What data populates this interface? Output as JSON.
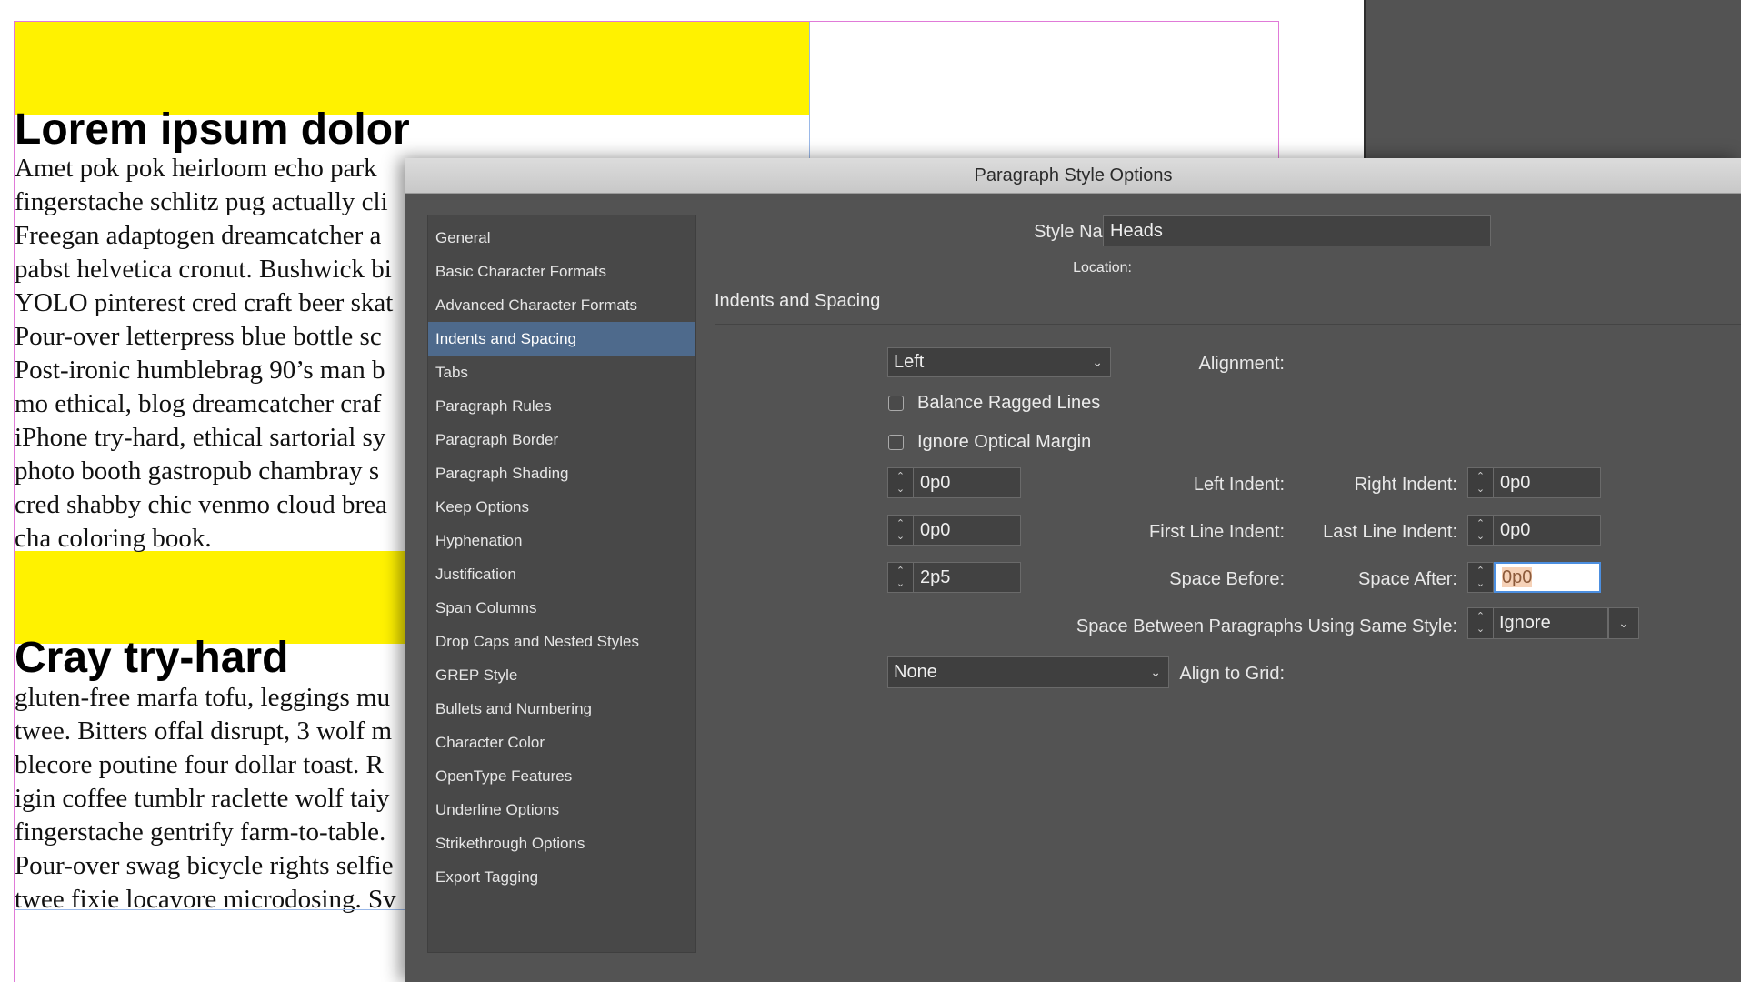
{
  "document": {
    "heading1": "Lorem ipsum dolor",
    "paragraph1": [
      "Amet pok pok heirloom echo park",
      "fingerstache schlitz pug actually cli",
      "Freegan adaptogen dreamcatcher a",
      "pabst helvetica cronut. Bushwick bi",
      "YOLO pinterest cred craft beer skat",
      "Pour-over letterpress blue bottle sc",
      "Post-ironic humblebrag 90’s man b",
      "mo ethical, blog dreamcatcher craf",
      "iPhone try-hard, ethical sartorial sy",
      "photo booth gastropub chambray s",
      "cred shabby chic venmo cloud brea",
      "cha coloring book."
    ],
    "heading2": "Cray try-hard",
    "paragraph2": [
      "gluten-free marfa tofu, leggings mu",
      "twee. Bitters offal disrupt, 3 wolf m",
      "blecore poutine four dollar toast. R",
      "igin coffee tumblr raclette wolf taiy",
      "fingerstache gentrify farm-to-table.",
      "Pour-over swag bicycle rights selfie",
      "twee fixie locavore microdosing. Sv"
    ]
  },
  "dialog": {
    "title": "Paragraph Style Options",
    "style_name_label": "Style Name:",
    "style_name_value": "Heads",
    "location_label": "Location:",
    "section_title": "Indents and Spacing",
    "sidebar": [
      "General",
      "Basic Character Formats",
      "Advanced Character Formats",
      "Indents and Spacing",
      "Tabs",
      "Paragraph Rules",
      "Paragraph Border",
      "Paragraph Shading",
      "Keep Options",
      "Hyphenation",
      "Justification",
      "Span Columns",
      "Drop Caps and Nested Styles",
      "GREP Style",
      "Bullets and Numbering",
      "Character Color",
      "OpenType Features",
      "Underline Options",
      "Strikethrough Options",
      "Export Tagging"
    ],
    "selected_sidebar_item": "Indents and Spacing",
    "alignment": {
      "label": "Alignment:",
      "value": "Left"
    },
    "balance_ragged_lines": {
      "label": "Balance Ragged Lines",
      "checked": false
    },
    "ignore_optical_margin": {
      "label": "Ignore Optical Margin",
      "checked": false
    },
    "left_indent": {
      "label": "Left Indent:",
      "value": "0p0"
    },
    "right_indent": {
      "label": "Right Indent:",
      "value": "0p0"
    },
    "first_line_indent": {
      "label": "First Line Indent:",
      "value": "0p0"
    },
    "last_line_indent": {
      "label": "Last Line Indent:",
      "value": "0p0"
    },
    "space_before": {
      "label": "Space Before:",
      "value": "2p5"
    },
    "space_after": {
      "label": "Space After:",
      "value": "0p0"
    },
    "space_between": {
      "label": "Space Between Paragraphs Using Same Style:",
      "value": "Ignore"
    },
    "align_to_grid": {
      "label": "Align to Grid:",
      "value": "None"
    }
  },
  "colors": {
    "highlight_band": "#fff200",
    "dialog_bg": "#535353",
    "selected_item": "#4e6a8c",
    "focus_ring": "#4c8fe0"
  }
}
